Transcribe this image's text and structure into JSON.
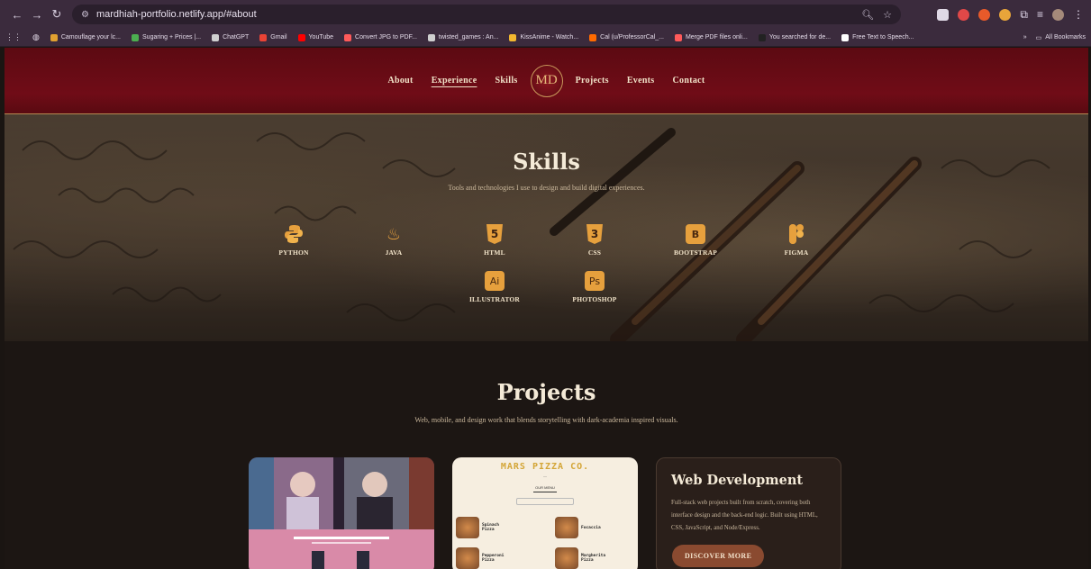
{
  "browser": {
    "url": "mardhiah-portfolio.netlify.app/#about",
    "bookmarks": [
      {
        "label": "Camouflage your lc...",
        "color": "#e0a030"
      },
      {
        "label": "Sugaring + Prices |...",
        "color": "#4caf50"
      },
      {
        "label": "ChatGPT",
        "color": "#d0d0d0"
      },
      {
        "label": "Gmail",
        "color": "#ea4335"
      },
      {
        "label": "YouTube",
        "color": "#ff0000"
      },
      {
        "label": "Convert JPG to PDF...",
        "color": "#ff5a5a"
      },
      {
        "label": "twisted_games : An...",
        "color": "#cfcfcf"
      },
      {
        "label": "KissAnime - Watch...",
        "color": "#f2b72f"
      },
      {
        "label": "Cal (u/ProfessorCal_...",
        "color": "#ff6a00"
      },
      {
        "label": "Merge PDF files onli...",
        "color": "#ff5a5a"
      },
      {
        "label": "You searched for de...",
        "color": "#222222"
      },
      {
        "label": "Free Text to Speech...",
        "color": "#ffffff"
      }
    ],
    "all_bookmarks": "All Bookmarks"
  },
  "nav": {
    "links": [
      "About",
      "Experience",
      "Skills",
      "Projects",
      "Events",
      "Contact"
    ],
    "logo": "MD",
    "active": "Experience"
  },
  "skills": {
    "title": "Skills",
    "subtitle": "Tools and technologies I use to design and build digital experiences.",
    "items": [
      "PYTHON",
      "JAVA",
      "HTML",
      "CSS",
      "BOOTSTRAP",
      "FIGMA",
      "ILLUSTRATOR",
      "PHOTOSHOP"
    ],
    "accent": "#e6a03d"
  },
  "projects": {
    "title": "Projects",
    "subtitle": "Web, mobile, and design work that blends storytelling with dark-academia inspired visuals.",
    "card2": {
      "title": "MARS PIZZA CO.",
      "tab": "OUR MENU",
      "items": [
        "Spinach Pizza",
        "Focaccia",
        "Pepperoni Pizza",
        "Margherita Pizza"
      ]
    },
    "card3": {
      "title": "Web Development",
      "text": "Full-stack web projects built from scratch, covering both interface design and the back-end logic. Built using HTML, CSS, JavaScript, and Node/Express.",
      "button": "DISCOVER MORE"
    }
  }
}
